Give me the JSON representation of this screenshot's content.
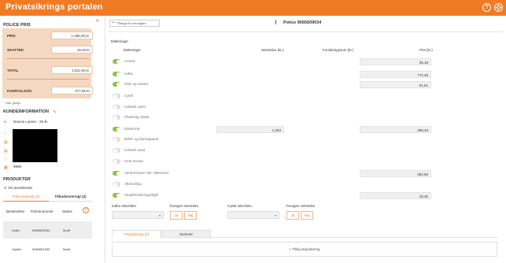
{
  "app": {
    "title": "Privatsikrings portalen",
    "help_icon": "?",
    "settings_icon": "gear"
  },
  "sidebar": {
    "collapse_icon": "«",
    "price": {
      "title": "POLICE PRIS",
      "rows": [
        {
          "label": "PRIS",
          "value": "1.495,00 kr."
        },
        {
          "label": "SKATTER",
          "value": "16,45 kr"
        },
        {
          "label": "TOTAL",
          "value": "1.511,45 kr."
        },
        {
          "label": "KVARTALSVIS",
          "value": "377,86 kr"
        }
      ],
      "note": "* Inkl. gebyr"
    },
    "customer": {
      "title": "KUNDEINFORMATION",
      "name": "Dennis Larsen - 28 år",
      "postcode": "9998"
    },
    "products": {
      "title": "PRODUKTER",
      "show_cancelled": "Vis annullerede",
      "tabs": [
        "Policeoversigt (2)",
        "Tilbudsoversigt (2)"
      ],
      "columns": [
        "Beskrivelse",
        "Policenummer",
        "Status"
      ],
      "rows": [
        {
          "desc": "Indbo",
          "number": "9065609034",
          "status": "Ikraft"
        },
        {
          "desc": "Ulykke",
          "number": "9065601939",
          "status": "Ikraft"
        }
      ]
    }
  },
  "main": {
    "back_label": "Tilbage til oversigten",
    "police_label": "Police",
    "police_number": "9065609034",
    "section_title": "Dækninger",
    "columns": {
      "coverage": "Dækninger",
      "deductible": "Selvrisiko (kr.)",
      "sum": "Forsikringssum (kr.)",
      "price": "Pris (kr.)"
    },
    "coverages": [
      {
        "label": "Ansvar",
        "on": true,
        "deductible": "",
        "price": "25,18"
      },
      {
        "label": "Indbo",
        "on": true,
        "deductible": "",
        "price": "774,48"
      },
      {
        "label": "Glas og sanitet",
        "on": true,
        "deductible": "",
        "price": "51,51"
      },
      {
        "label": "Cykel",
        "on": false,
        "deductible": "",
        "price": ""
      },
      {
        "label": "Udvidet cykel",
        "on": false,
        "deductible": "",
        "price": ""
      },
      {
        "label": "Pludselig skade",
        "on": false,
        "deductible": "",
        "price": ""
      },
      {
        "label": "Elektronik",
        "on": true,
        "deductible": "1.253",
        "price": "289,33"
      },
      {
        "label": "Briller og høreapparat",
        "on": false,
        "deductible": "",
        "price": ""
      },
      {
        "label": "Udvidet vand",
        "on": false,
        "deductible": "",
        "price": ""
      },
      {
        "label": "Hest ansvar",
        "on": false,
        "deductible": "",
        "price": ""
      },
      {
        "label": "Verdensrejse inkl. sikkerhed",
        "on": true,
        "deductible": "",
        "price": "354,50"
      },
      {
        "label": "Afbestilling",
        "on": false,
        "deductible": "",
        "price": ""
      },
      {
        "label": "Skadeforsikringsafgift",
        "on": true,
        "deductible": "",
        "price": "16,45"
      }
    ],
    "options": {
      "indbo_label": "Indbo selvrisiko",
      "tvungen_label": "Tvungen selvrisiko",
      "cykel_label": "Cykel selvrisiko",
      "tvungen2_label": "Tvungen selvrisiko",
      "yes": "Ja",
      "no": "Nej"
    },
    "bottom_tabs": [
      "Prisjustering (0)",
      "Summer"
    ],
    "add_label": "+ Tilføj prisjustering"
  },
  "colors": {
    "accent": "#f07b24",
    "toggle_on": "#8bc34a",
    "panel": "#f5d8bf"
  }
}
